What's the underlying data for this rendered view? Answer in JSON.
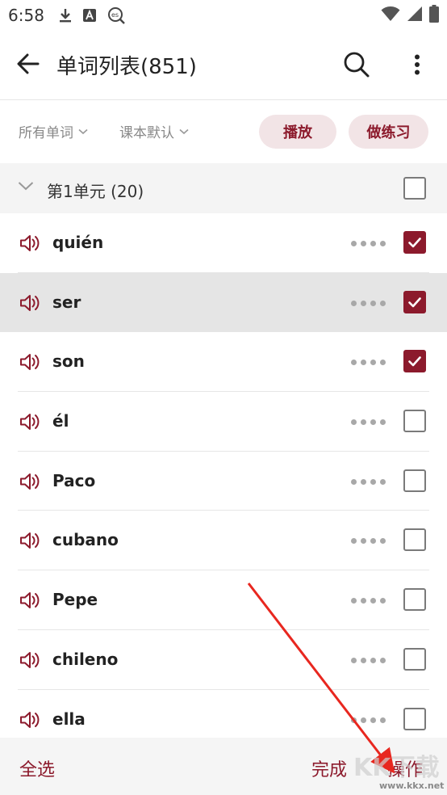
{
  "status_bar": {
    "time": "6:58",
    "icons": [
      "download-icon",
      "font-a-icon",
      "es-search-icon",
      "wifi-icon",
      "signal-icon",
      "battery-icon"
    ]
  },
  "app_bar": {
    "title": "单词列表(851)",
    "icons": [
      "back-arrow-icon",
      "search-icon",
      "more-vert-icon"
    ]
  },
  "filters": {
    "all_words": "所有单词",
    "textbook_default": "课本默认",
    "play_label": "播放",
    "practice_label": "做练习"
  },
  "unit": {
    "label": "第1单元 (20)",
    "checked": false
  },
  "words": [
    {
      "word": "quién",
      "checked": true,
      "highlighted": false
    },
    {
      "word": "ser",
      "checked": true,
      "highlighted": true
    },
    {
      "word": "son",
      "checked": true,
      "highlighted": false
    },
    {
      "word": "él",
      "checked": false,
      "highlighted": false
    },
    {
      "word": "Paco",
      "checked": false,
      "highlighted": false
    },
    {
      "word": "cubano",
      "checked": false,
      "highlighted": false
    },
    {
      "word": "Pepe",
      "checked": false,
      "highlighted": false
    },
    {
      "word": "chileno",
      "checked": false,
      "highlighted": false
    },
    {
      "word": "ella",
      "checked": false,
      "highlighted": false
    }
  ],
  "bottom_bar": {
    "select_all": "全选",
    "done": "完成",
    "operations": "操作"
  },
  "watermark": {
    "url": "www.kkx.net"
  },
  "colors": {
    "accent": "#8c1a2c",
    "pill_bg": "#f2e4e6",
    "highlight_row": "#e5e5e5",
    "arrow": "#e8271f"
  }
}
